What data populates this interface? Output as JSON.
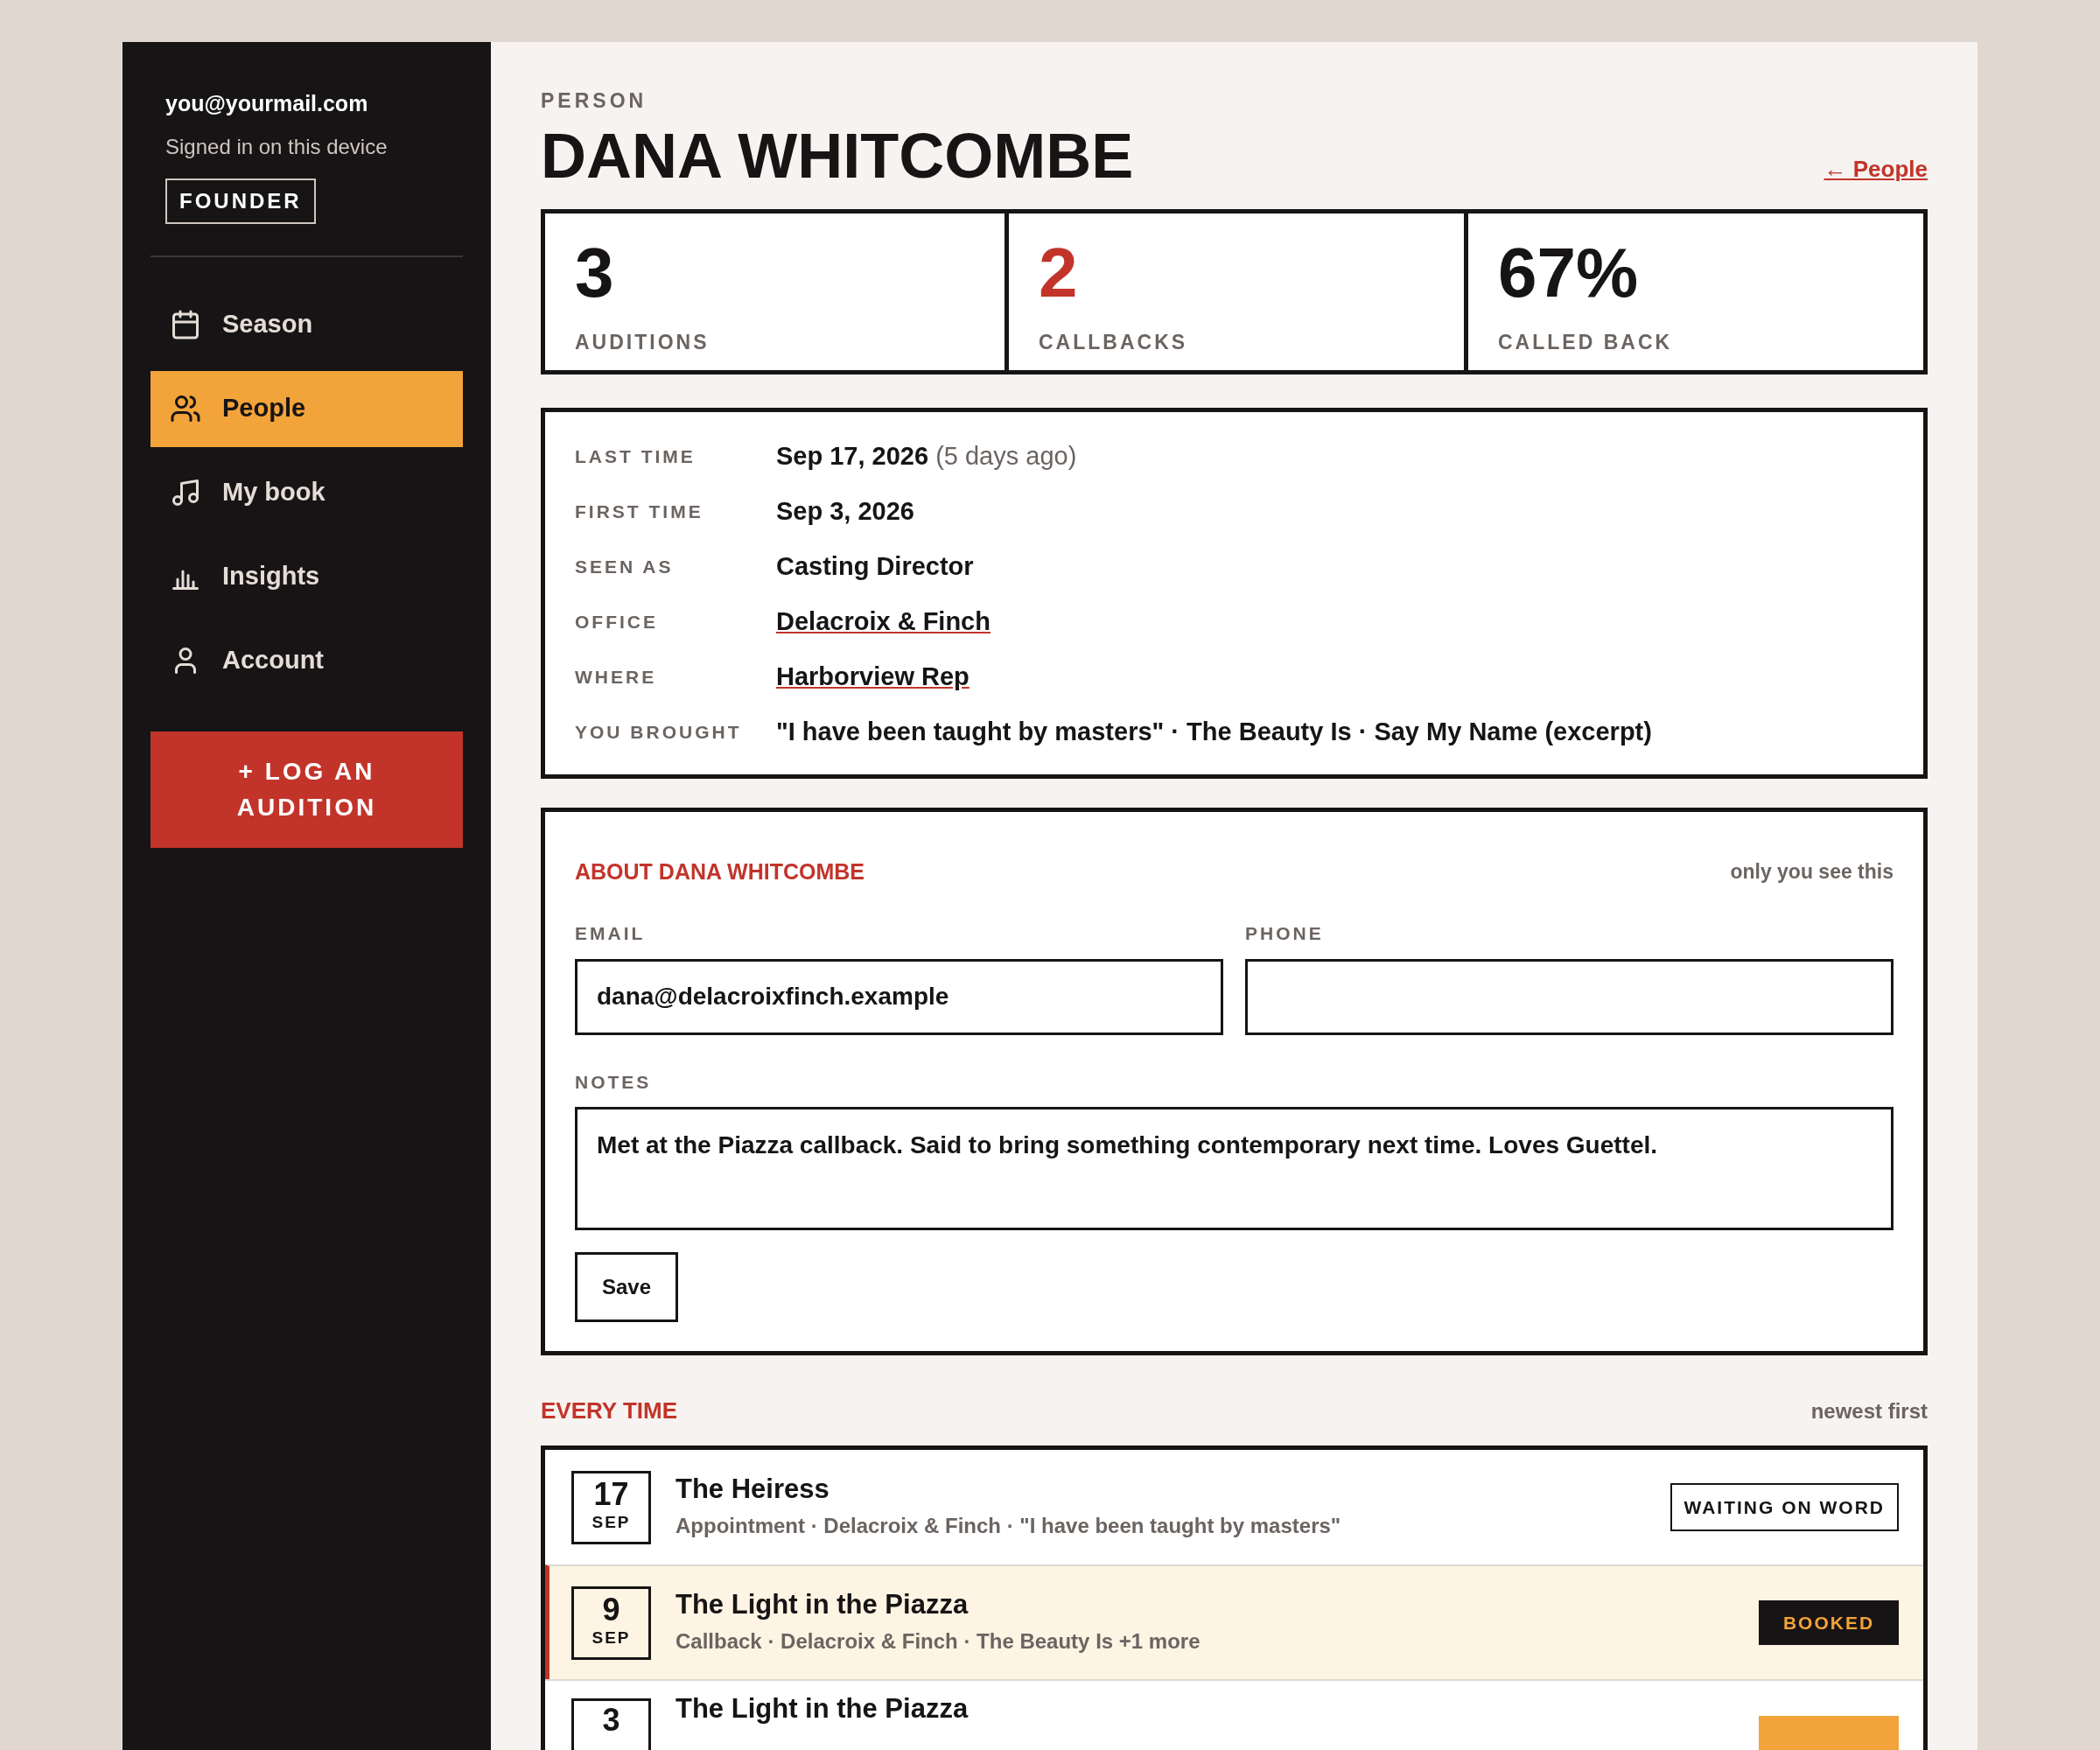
{
  "sidebar": {
    "email": "you@yourmail.com",
    "status": "Signed in on this device",
    "role": "FOUNDER",
    "items": [
      {
        "label": "Season",
        "selected": false
      },
      {
        "label": "People",
        "selected": true
      },
      {
        "label": "My book",
        "selected": false
      },
      {
        "label": "Insights",
        "selected": false
      },
      {
        "label": "Account",
        "selected": false
      }
    ],
    "action": "+ LOG AN AUDITION"
  },
  "header": {
    "eyebrow": "PERSON",
    "title": "DANA WHITCOMBE",
    "back_link": "← People"
  },
  "stats": [
    {
      "value": "3",
      "label": "AUDITIONS",
      "accent": false
    },
    {
      "value": "2",
      "label": "CALLBACKS",
      "accent": true
    },
    {
      "value": "67%",
      "label": "CALLED BACK",
      "accent": false
    }
  ],
  "details": [
    {
      "label": "LAST TIME",
      "value": "Sep 17, 2026",
      "note": "(5 days ago)",
      "kind": "text"
    },
    {
      "label": "FIRST TIME",
      "value": "Sep 3, 2026",
      "kind": "text"
    },
    {
      "label": "SEEN AS",
      "value": "Casting Director",
      "kind": "text"
    },
    {
      "label": "OFFICE",
      "value": "Delacroix & Finch",
      "kind": "link"
    },
    {
      "label": "WHERE",
      "value": "Harborview Rep",
      "kind": "link"
    },
    {
      "label": "YOU BROUGHT",
      "value": "\"I have been taught by masters\" · The Beauty Is · Say My Name (excerpt)",
      "kind": "text"
    }
  ],
  "about": {
    "title": "ABOUT DANA WHITCOMBE",
    "privacy": "only you see this",
    "email": {
      "label": "EMAIL",
      "value": "dana@delacroixfinch.example"
    },
    "phone": {
      "label": "PHONE"
    },
    "notes": {
      "label": "NOTES",
      "value": "Met at the Piazza callback. Said to bring something contemporary next time. Loves Guettel."
    },
    "save": "Save"
  },
  "history": {
    "title": "EVERY TIME",
    "sort": "newest first",
    "rows": [
      {
        "day": "17",
        "month": "SEP",
        "title": "The Heiress",
        "meta": "Appointment · Delacroix & Finch · \"I have been taught by masters\"",
        "status": "WAITING ON WORD",
        "kind": "outline",
        "selected": false
      },
      {
        "day": "9",
        "month": "SEP",
        "title": "The Light in the Piazza",
        "meta": "Callback · Delacroix & Finch · The Beauty Is +1 more",
        "status": "BOOKED",
        "kind": "dark",
        "selected": true
      },
      {
        "day": "3",
        "title": "The Light in the Piazza",
        "kind": "amber",
        "selected": false
      }
    ]
  }
}
